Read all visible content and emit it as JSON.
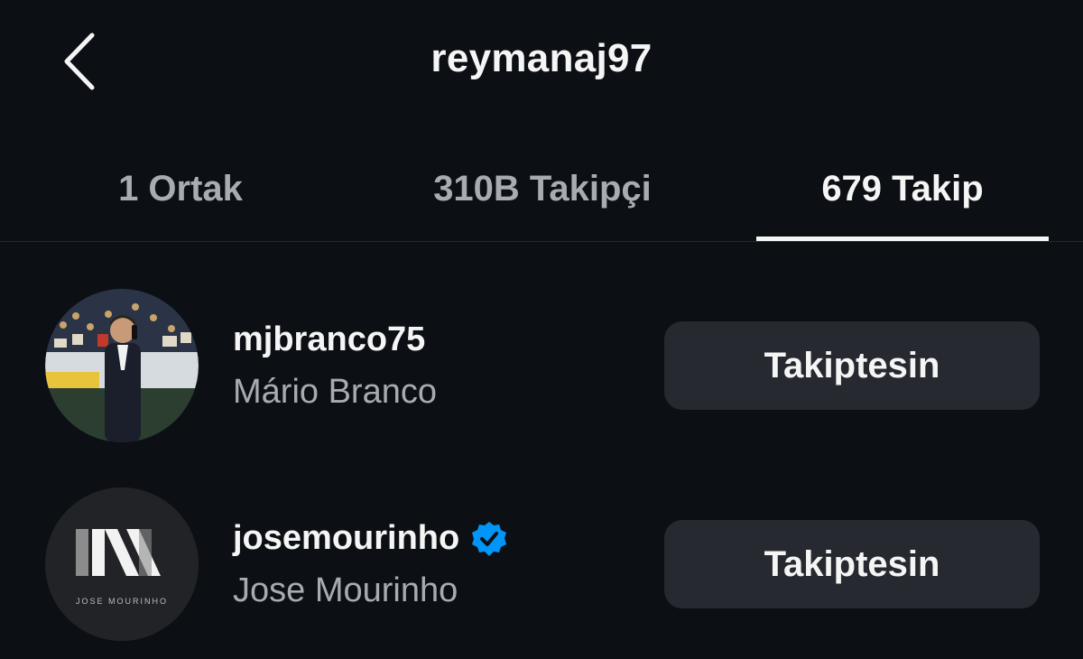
{
  "header": {
    "title": "reymanaj97",
    "back_icon": "chevron-left-icon"
  },
  "tabs": [
    {
      "label": "1 Ortak",
      "active": false
    },
    {
      "label": "310B Takipçi",
      "active": false
    },
    {
      "label": "679 Takip",
      "active": true
    }
  ],
  "list": [
    {
      "username": "mjbranco75",
      "full_name": "Mário Branco",
      "verified": false,
      "button_label": "Takiptesin",
      "avatar": "stadium-photo-avatar"
    },
    {
      "username": "josemourinho",
      "full_name": "Jose Mourinho",
      "verified": true,
      "button_label": "Takiptesin",
      "avatar": "jm-logo-avatar",
      "avatar_text": "JOSE MOURINHO"
    }
  ],
  "colors": {
    "background": "#0c1014",
    "button_bg": "#262a30",
    "verified_blue": "#0095f6",
    "muted_text": "#a8acb2"
  }
}
